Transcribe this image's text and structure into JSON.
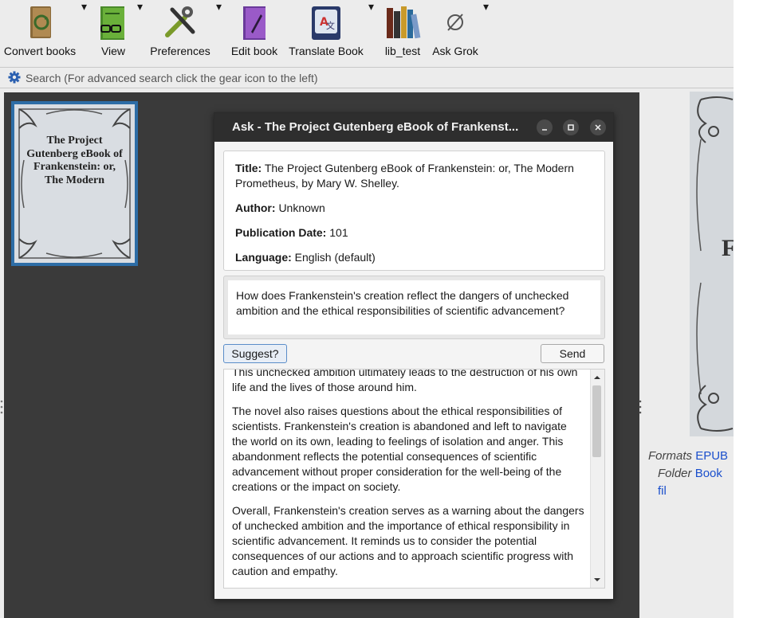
{
  "toolbar": {
    "items": [
      {
        "label": "Convert books",
        "icon": "convert-books-icon"
      },
      {
        "label": "View",
        "icon": "view-book-icon"
      },
      {
        "label": "Preferences",
        "icon": "preferences-tools-icon"
      },
      {
        "label": "Edit book",
        "icon": "edit-book-icon"
      },
      {
        "label": "Translate Book",
        "icon": "translate-book-icon"
      },
      {
        "label": "lib_test",
        "icon": "library-icon"
      },
      {
        "label": "Ask Grok",
        "icon": "ask-grok-icon"
      }
    ]
  },
  "search": {
    "placeholder": "Search (For advanced search click the gear icon to the left)"
  },
  "library": {
    "cover_title": "The Project Gutenberg eBook of Frankenstein: or, The Modern",
    "big_cover_letter": "F"
  },
  "details": {
    "formats_label": "Formats",
    "formats_value": "EPUB",
    "folder_label": "Folder",
    "folder_value": "Book fil"
  },
  "dialog": {
    "title": "Ask - The Project Gutenberg eBook of Frankenst...",
    "info": {
      "title_label": "Title:",
      "title_value": "The Project Gutenberg eBook of Frankenstein: or, The Modern Prometheus, by Mary W. Shelley.",
      "author_label": "Author:",
      "author_value": "Unknown",
      "pubdate_label": "Publication Date:",
      "pubdate_value": "101",
      "language_label": "Language:",
      "language_value": "English (default)"
    },
    "question": "How does Frankenstein's creation reflect the dangers of unchecked ambition and the ethical responsibilities of scientific advancement?",
    "suggest_label": "Suggest?",
    "send_label": "Send",
    "answer": [
      "This unchecked ambition ultimately leads to the destruction of his own life and the lives of those around him.",
      "The novel also raises questions about the ethical responsibilities of scientists. Frankenstein's creation is abandoned and left to navigate the world on its own, leading to feelings of isolation and anger. This abandonment reflects the potential consequences of scientific advancement without proper consideration for the well-being of the creations or the impact on society.",
      "Overall, Frankenstein's creation serves as a warning about the dangers of unchecked ambition and the importance of ethical responsibility in scientific advancement. It reminds us to consider the potential consequences of our actions and to approach scientific progress with caution and empathy."
    ]
  }
}
